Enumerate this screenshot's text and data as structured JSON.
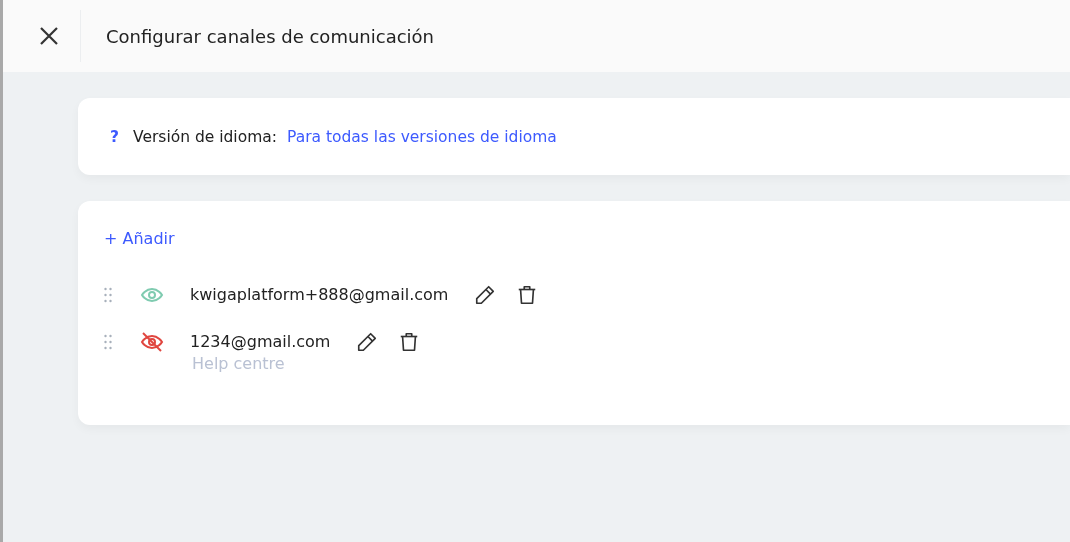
{
  "header": {
    "title": "Configurar canales de comunicación"
  },
  "language": {
    "help": "?",
    "label": "Versión de idioma:",
    "value": "Para todas las versiones de idioma"
  },
  "add_button": "+ Añadir",
  "channels": [
    {
      "email": "kwigaplatform+888@gmail.com",
      "visible": true
    },
    {
      "email": "1234@gmail.com",
      "visible": false,
      "subtitle": "Help centre"
    }
  ]
}
